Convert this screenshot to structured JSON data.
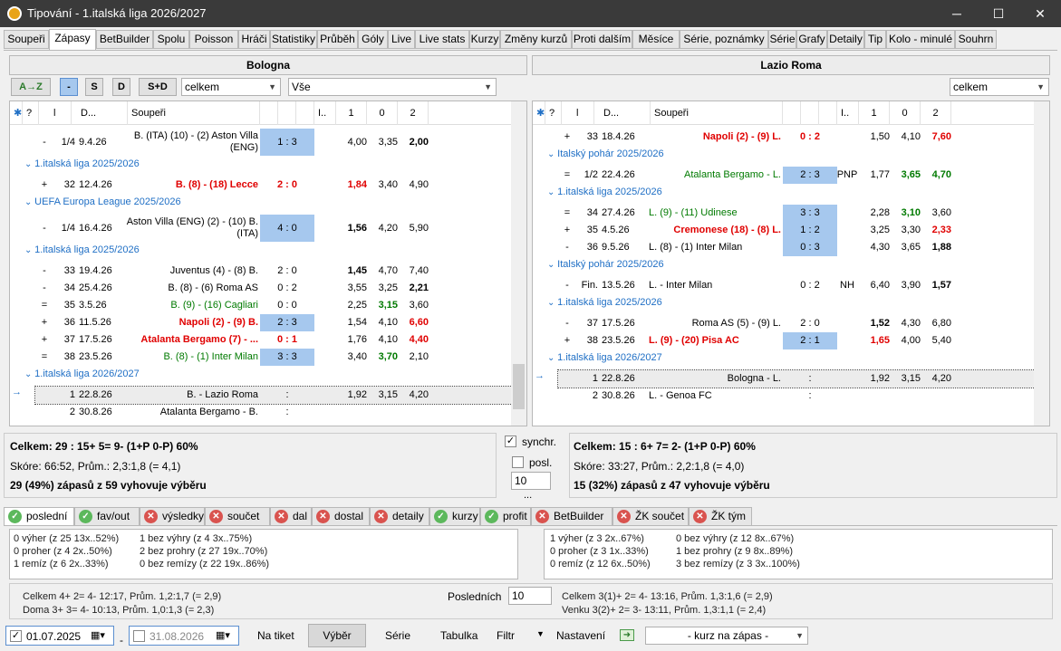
{
  "window": {
    "title": "Tipování - 1.italská liga 2026/2027",
    "min": "─",
    "max": "☐",
    "close": "✕"
  },
  "tabs": [
    "Soupeři",
    "Zápasy",
    "BetBuilder",
    "Spolu",
    "Poisson",
    "Hráči",
    "Statistiky",
    "Průběh",
    "Góly",
    "Live",
    "Live stats",
    "Kurzy",
    "Změny kurzů",
    "Proti dalším",
    "Měsíce",
    "Série, poznámky",
    "Série",
    "Grafy",
    "Detaily",
    "Tip",
    "Kolo - minulé",
    "Souhrn"
  ],
  "left_team": "Bologna",
  "right_team": "Lazio Roma",
  "filter": {
    "sort_icon": "A→Z",
    "minus": "-",
    "s": "S",
    "d": "D",
    "sd": "S+D",
    "left_combo1": "celkem",
    "left_combo2": "Vše",
    "right_combo": "celkem"
  },
  "grid_header": {
    "q": "?",
    "l": "l",
    "d": "D...",
    "soup": "Soupeři",
    "i": "I..",
    "c1": "1",
    "c0": "0",
    "c2": "2"
  },
  "left_rows": [
    {
      "k": "r",
      "s": "-",
      "n": "1/4",
      "d": "9.4.26",
      "t": "B. (ITA) (10) - (2) Aston Villa (ENG)",
      "sc": "1 : 3",
      "hl": true,
      "o1": "4,00",
      "o0": "3,35",
      "o2": "2,00",
      "b2": true
    },
    {
      "k": "g",
      "t": "1.italská liga 2025/2026"
    },
    {
      "k": "r",
      "s": "+",
      "n": "32",
      "d": "12.4.26",
      "t": "B. (8) - (18) Lecce",
      "sc": "2 : 0",
      "red": true,
      "o1": "1,84",
      "o0": "3,40",
      "o2": "4,90",
      "r1": true
    },
    {
      "k": "g",
      "t": "UEFA Europa League 2025/2026"
    },
    {
      "k": "r",
      "s": "-",
      "n": "1/4",
      "d": "16.4.26",
      "t": "Aston Villa (ENG) (2) - (10) B. (ITA)",
      "sc": "4 : 0",
      "hl": true,
      "o1": "1,56",
      "o0": "4,20",
      "o2": "5,90",
      "b1": true
    },
    {
      "k": "g",
      "t": "1.italská liga 2025/2026"
    },
    {
      "k": "r",
      "s": "-",
      "n": "33",
      "d": "19.4.26",
      "t": "Juventus (4) - (8) B.",
      "sc": "2 : 0",
      "o1": "1,45",
      "o0": "4,70",
      "o2": "7,40",
      "b1": true
    },
    {
      "k": "r",
      "s": "-",
      "n": "34",
      "d": "25.4.26",
      "t": "B. (8) - (6) Roma AS",
      "sc": "0 : 2",
      "o1": "3,55",
      "o0": "3,25",
      "o2": "2,21",
      "b2": true
    },
    {
      "k": "r",
      "s": "=",
      "n": "35",
      "d": "3.5.26",
      "t": "B. (9) - (16) Cagliari",
      "sc": "0 : 0",
      "grn": true,
      "o1": "2,25",
      "o0": "3,15",
      "o2": "3,60",
      "g0": true
    },
    {
      "k": "r",
      "s": "+",
      "n": "36",
      "d": "11.5.26",
      "t": "Napoli (2) - (9) B.",
      "sc": "2 : 3",
      "hl": true,
      "red": true,
      "o1": "1,54",
      "o0": "4,10",
      "o2": "6,60",
      "r2": true
    },
    {
      "k": "r",
      "s": "+",
      "n": "37",
      "d": "17.5.26",
      "t": "Atalanta Bergamo (7) - ...",
      "sc": "0 : 1",
      "red": true,
      "o1": "1,76",
      "o0": "4,10",
      "o2": "4,40",
      "r2": true
    },
    {
      "k": "r",
      "s": "=",
      "n": "38",
      "d": "23.5.26",
      "t": "B. (8) - (1) Inter Milan",
      "sc": "3 : 3",
      "hl": true,
      "grn": true,
      "o1": "3,40",
      "o0": "3,70",
      "o2": "2,10",
      "g0": true
    },
    {
      "k": "g",
      "t": "1.italská liga 2026/2027"
    },
    {
      "k": "r",
      "s": "",
      "n": "1",
      "d": "22.8.26",
      "t": "B. - Lazio Roma",
      "sc": ":",
      "sel": true,
      "o1": "1,92",
      "o0": "3,15",
      "o2": "4,20"
    },
    {
      "k": "r",
      "s": "",
      "n": "2",
      "d": "30.8.26",
      "t": "Atalanta Bergamo - B.",
      "sc": ":",
      "o1": "",
      "o0": "",
      "o2": ""
    }
  ],
  "right_rows": [
    {
      "k": "r",
      "s": "+",
      "n": "33",
      "d": "18.4.26",
      "t": "Napoli (2) - (9) L.",
      "sc": "0 : 2",
      "red": true,
      "scred": true,
      "o1": "1,50",
      "o0": "4,10",
      "o2": "7,60",
      "r2": true
    },
    {
      "k": "g",
      "t": "Italský pohár 2025/2026"
    },
    {
      "k": "r",
      "s": "=",
      "n": "1/2",
      "d": "22.4.26",
      "t": "Atalanta Bergamo - L.",
      "sc": "2 : 3",
      "hl": true,
      "grn": true,
      "i": "PNP",
      "o1": "1,77",
      "o0": "3,65",
      "o2": "4,70",
      "g0": true,
      "g2": true
    },
    {
      "k": "g",
      "t": "1.italská liga 2025/2026"
    },
    {
      "k": "r",
      "s": "=",
      "n": "34",
      "d": "27.4.26",
      "t": "L. (9) - (11) Udinese",
      "sc": "3 : 3",
      "hl": true,
      "grn": true,
      "left": true,
      "o1": "2,28",
      "o0": "3,10",
      "o2": "3,60",
      "g0": true
    },
    {
      "k": "r",
      "s": "+",
      "n": "35",
      "d": "4.5.26",
      "t": "Cremonese (18) - (8) L.",
      "sc": "1 : 2",
      "hl": true,
      "red": true,
      "o1": "3,25",
      "o0": "3,30",
      "o2": "2,33",
      "r2": true
    },
    {
      "k": "r",
      "s": "-",
      "n": "36",
      "d": "9.5.26",
      "t": "L. (8) - (1) Inter Milan",
      "sc": "0 : 3",
      "hl": true,
      "left": true,
      "o1": "4,30",
      "o0": "3,65",
      "o2": "1,88",
      "b2": true
    },
    {
      "k": "g",
      "t": "Italský pohár 2025/2026"
    },
    {
      "k": "r",
      "s": "-",
      "n": "Fin.",
      "d": "13.5.26",
      "t": "L. - Inter Milan",
      "sc": "0 : 2",
      "left": true,
      "i": "NH",
      "o1": "6,40",
      "o0": "3,90",
      "o2": "1,57",
      "b2": true
    },
    {
      "k": "g",
      "t": "1.italská liga 2025/2026"
    },
    {
      "k": "r",
      "s": "-",
      "n": "37",
      "d": "17.5.26",
      "t": "Roma AS (5) - (9) L.",
      "sc": "2 : 0",
      "o1": "1,52",
      "o0": "4,30",
      "o2": "6,80",
      "b1": true
    },
    {
      "k": "r",
      "s": "+",
      "n": "38",
      "d": "23.5.26",
      "t": "L. (9) - (20) Pisa AC",
      "sc": "2 : 1",
      "hl": true,
      "red": true,
      "left": true,
      "o1": "1,65",
      "o0": "4,00",
      "o2": "5,40",
      "r1": true
    },
    {
      "k": "g",
      "t": "1.italská liga 2026/2027"
    },
    {
      "k": "r",
      "s": "",
      "n": "1",
      "d": "22.8.26",
      "t": "Bologna - L.",
      "sc": ":",
      "sel": true,
      "o1": "1,92",
      "o0": "3,15",
      "o2": "4,20"
    },
    {
      "k": "r",
      "s": "",
      "n": "2",
      "d": "30.8.26",
      "t": "L. - Genoa FC",
      "sc": ":",
      "left": true,
      "o1": "",
      "o0": "",
      "o2": ""
    }
  ],
  "left_stats": {
    "line1": "Celkem: 29 : 15+  5=  9- (1+P  0-P)  60%",
    "line2": "Skóre: 66:52, Prům.: 2,3:1,8 (= 4,1)",
    "line3": "29 (49%) zápasů z 59 vyhovuje výběru"
  },
  "right_stats": {
    "line1": "Celkem: 15 : 6+  7=  2- (1+P  0-P)  60%",
    "line2": "Skóre: 33:27, Prům.: 2,2:1,8 (= 4,0)",
    "line3": "15 (32%) zápasů z 47 vyhovuje výběru"
  },
  "mid": {
    "synchr": "synchr.",
    "posl": "posl.",
    "val": "10",
    "dots": "..."
  },
  "btabs": [
    {
      "l": "poslední",
      "ok": true
    },
    {
      "l": "fav/out",
      "ok": true
    },
    {
      "l": "výsledky",
      "ok": false
    },
    {
      "l": "součet",
      "ok": false
    },
    {
      "l": "dal",
      "ok": false
    },
    {
      "l": "dostal",
      "ok": false
    },
    {
      "l": "detaily",
      "ok": false
    },
    {
      "l": "kurzy",
      "ok": true
    },
    {
      "l": "profit",
      "ok": true
    },
    {
      "l": "BetBuilder",
      "ok": false
    },
    {
      "l": "ŽK součet",
      "ok": false
    },
    {
      "l": "ŽK tým",
      "ok": false
    }
  ],
  "left_series": {
    "c1": [
      "0 výher (z 25 13x..52%)",
      "0 proher (z 4 2x..50%)",
      "1 remíz (z 6 2x..33%)"
    ],
    "c2": [
      "1 bez výhry (z 4 3x..75%)",
      "2 bez prohry (z 27 19x..70%)",
      "0 bez remízy (z 22 19x..86%)"
    ]
  },
  "right_series": {
    "c1": [
      "1 výher (z 3 2x..67%)",
      "0 proher (z 3 1x..33%)",
      "0 remíz (z 12 6x..50%)"
    ],
    "c2": [
      "0 bez výhry (z 12 8x..67%)",
      "1 bez prohry (z 9 8x..89%)",
      "3 bez remízy (z 3 3x..100%)"
    ]
  },
  "last": {
    "left1": "Celkem 4+   2=   4-   12:17,  Prům. 1,2:1,7 (= 2,9)",
    "left2": "Doma   3+   3=   4-   10:13,  Prům. 1,0:1,3 (= 2,3)",
    "label": "Posledních",
    "val": "10",
    "right1": "Celkem   3(1)+   2=   4-   13:16,  Prům. 1,3:1,6 (= 2,9)",
    "right2": "Venku    3(2)+   2=   3-   13:11,  Prům. 1,3:1,1 (= 2,4)"
  },
  "toolbar": {
    "date1": "01.07.2025",
    "date2": "31.08.2026",
    "tiket": "Na tiket",
    "vyber": "Výběr",
    "serie": "Série",
    "tabulka": "Tabulka",
    "filtr": "Filtr",
    "nastaveni": "Nastavení",
    "kurz": "- kurz na zápas -"
  }
}
